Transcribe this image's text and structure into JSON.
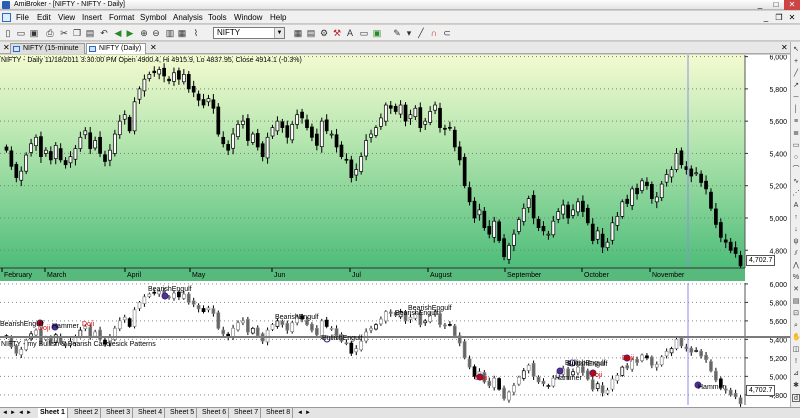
{
  "window": {
    "title": "AmiBroker - [NIFTY - NIFTY - Daily]",
    "minimize": "_",
    "maximize": "□",
    "close": "✕"
  },
  "menu": {
    "items": [
      "File",
      "Edit",
      "View",
      "Insert",
      "Format",
      "Symbol",
      "Analysis",
      "Tools",
      "Window",
      "Help"
    ],
    "mdi_minimize": "_",
    "mdi_restore": "❐",
    "mdi_close": "✕"
  },
  "toolbar": {
    "symbol": "NIFTY"
  },
  "tabs": [
    {
      "label": "NIFTY (15-minute",
      "active": false
    },
    {
      "label": "NIFTY (Daily)",
      "active": true
    }
  ],
  "tab_close": "✕",
  "price_pane": {
    "title": "NIFTY - Daily 11/18/2011 3:30:00 PM Open 4900.4, Hi 4915.9, Lo 4837.95, Close 4914.1 (-0.3%)",
    "y_ticks": [
      "6,000",
      "5,800",
      "5,600",
      "5,400",
      "5,200",
      "5,000",
      "4,800"
    ],
    "last_price": "4,702.7",
    "months": [
      "February",
      "March",
      "April",
      "May",
      "Jun",
      "Jul",
      "August",
      "September",
      "October",
      "November"
    ]
  },
  "pattern_pane": {
    "title": "NIFTY - my Bullish & Bearish Candlesick Patterns",
    "y_ticks": [
      "6,000",
      "5,800",
      "5,600",
      "5,400",
      "5,200",
      "5,000",
      "4,800"
    ],
    "last_price": "4,702.7",
    "labels": [
      {
        "text": "BearishEngulf",
        "kind": "bear"
      },
      {
        "text": "Doji",
        "kind": "doji"
      },
      {
        "text": "Hammer",
        "kind": "bull"
      },
      {
        "text": "Doji",
        "kind": "doji"
      },
      {
        "text": "BearishEngulf",
        "kind": "bear"
      },
      {
        "text": "BullishEngulf",
        "kind": "bull"
      },
      {
        "text": "BearishEngulf",
        "kind": "bear"
      },
      {
        "text": "BearishEngulf",
        "kind": "bear"
      },
      {
        "text": "BearishEngulf",
        "kind": "bear"
      },
      {
        "text": "BullishEngulf",
        "kind": "bull"
      },
      {
        "text": "Doji",
        "kind": "doji"
      },
      {
        "text": "BullishEngulf",
        "kind": "bull"
      },
      {
        "text": "Hammer",
        "kind": "bull"
      },
      {
        "text": "Doji",
        "kind": "doji"
      },
      {
        "text": "Doji",
        "kind": "doji"
      },
      {
        "text": "Hammer",
        "kind": "bull"
      }
    ]
  },
  "sheets": [
    "Sheet 1",
    "Sheet 2",
    "Sheet 3",
    "Sheet 4",
    "Sheet 5",
    "Sheet 6",
    "Sheet 7",
    "Sheet 8"
  ],
  "sheet_nav": [
    "◄",
    "►"
  ],
  "chart_data": [
    {
      "type": "candlestick",
      "ylim": [
        4690,
        6010
      ],
      "y_ticks": [
        6000,
        5800,
        5600,
        5400,
        5200,
        5000,
        4800
      ],
      "x_ticks": [
        "February",
        "March",
        "April",
        "May",
        "Jun",
        "Jul",
        "August",
        "September",
        "October",
        "November"
      ],
      "close_approx": [
        5420,
        5320,
        5250,
        5290,
        5390,
        5460,
        5500,
        5380,
        5420,
        5360,
        5450,
        5360,
        5330,
        5380,
        5430,
        5500,
        5540,
        5430,
        5480,
        5400,
        5350,
        5420,
        5520,
        5600,
        5640,
        5540,
        5720,
        5800,
        5860,
        5890,
        5900,
        5920,
        5880,
        5850,
        5900,
        5860,
        5890,
        5800,
        5780,
        5730,
        5700,
        5740,
        5680,
        5520,
        5460,
        5420,
        5520,
        5580,
        5600,
        5480,
        5520,
        5440,
        5380,
        5500,
        5560,
        5600,
        5560,
        5500,
        5580,
        5640,
        5620,
        5560,
        5500,
        5450,
        5600,
        5540,
        5520,
        5440,
        5380,
        5360,
        5250,
        5300,
        5380,
        5480,
        5520,
        5560,
        5620,
        5700,
        5680,
        5660,
        5700,
        5600,
        5640,
        5680,
        5560,
        5600,
        5660,
        5700,
        5560,
        5550,
        5560,
        5440,
        5360,
        5200,
        5100,
        5000,
        5050,
        4940,
        4900,
        4980,
        4860,
        4760,
        4830,
        4900,
        4990,
        5060,
        5120,
        5000,
        4940,
        4920,
        4900,
        4980,
        5040,
        5080,
        5000,
        5050,
        5100,
        5040,
        4970,
        4860,
        4920,
        4820,
        4850,
        4970,
        5010,
        5100,
        5090,
        5180,
        5150,
        5230,
        5200,
        5120,
        5130,
        5210,
        5270,
        5300,
        5400,
        5330,
        5300,
        5260,
        5280,
        5220,
        5180,
        5060,
        4960,
        4880,
        4850,
        4800,
        4780,
        4703
      ],
      "last_value": 4702.7,
      "crosshair_label": "November"
    },
    {
      "type": "candlestick",
      "title": "NIFTY - my Bullish & Bearish Candlesick Patterns",
      "ylim": [
        4690,
        6010
      ],
      "y_ticks": [
        6000,
        5800,
        5600,
        5400,
        5200,
        5000,
        4800
      ],
      "last_value": 4702.7
    }
  ]
}
